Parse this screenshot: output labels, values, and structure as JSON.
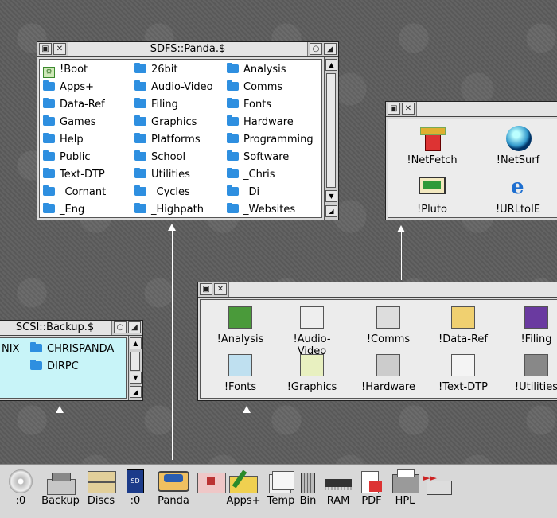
{
  "panda_window": {
    "title": "SDFS::Panda.$",
    "columns": [
      [
        "!Boot",
        "Apps+",
        "Data-Ref",
        "Games",
        "Help",
        "Public",
        "Text-DTP",
        "_Cornant",
        "_Eng"
      ],
      [
        "26bit",
        "Audio-Video",
        "Filing",
        "Graphics",
        "Platforms",
        "School",
        "Utilities",
        "_Cycles",
        "_Highpath"
      ],
      [
        "Analysis",
        "Comms",
        "Fonts",
        "Hardware",
        "Programming",
        "Software",
        "_Chris",
        "_Di",
        "_Websites"
      ]
    ]
  },
  "internet_window": {
    "items": [
      "!NetFetch",
      "!NetSurf",
      "!Pluto",
      "!URLtoIE"
    ]
  },
  "apps_window": {
    "row1": [
      "!Analysis",
      "!Audio-Video",
      "!Comms",
      "!Data-Ref",
      "!Filing"
    ],
    "row2": [
      "!Fonts",
      "!Graphics",
      "!Hardware",
      "!Text-DTP",
      "!Utilities"
    ]
  },
  "backup_window": {
    "title": "SCSI::Backup.$",
    "partial_item": "NIX",
    "items": [
      "CHRISPANDA",
      "DIRPC"
    ],
    "bg_color": "#c8f4f8"
  },
  "iconbar": {
    "items": [
      ":0",
      "Backup",
      "Discs",
      ":0",
      "Panda",
      "",
      "Apps+",
      "Temp",
      "Bin",
      "RAM",
      "PDF",
      "HPL",
      ""
    ]
  },
  "colors": {
    "folder": "#2e8fe0",
    "desktop": "#5e5e5e",
    "window": "#dcdcdc"
  }
}
